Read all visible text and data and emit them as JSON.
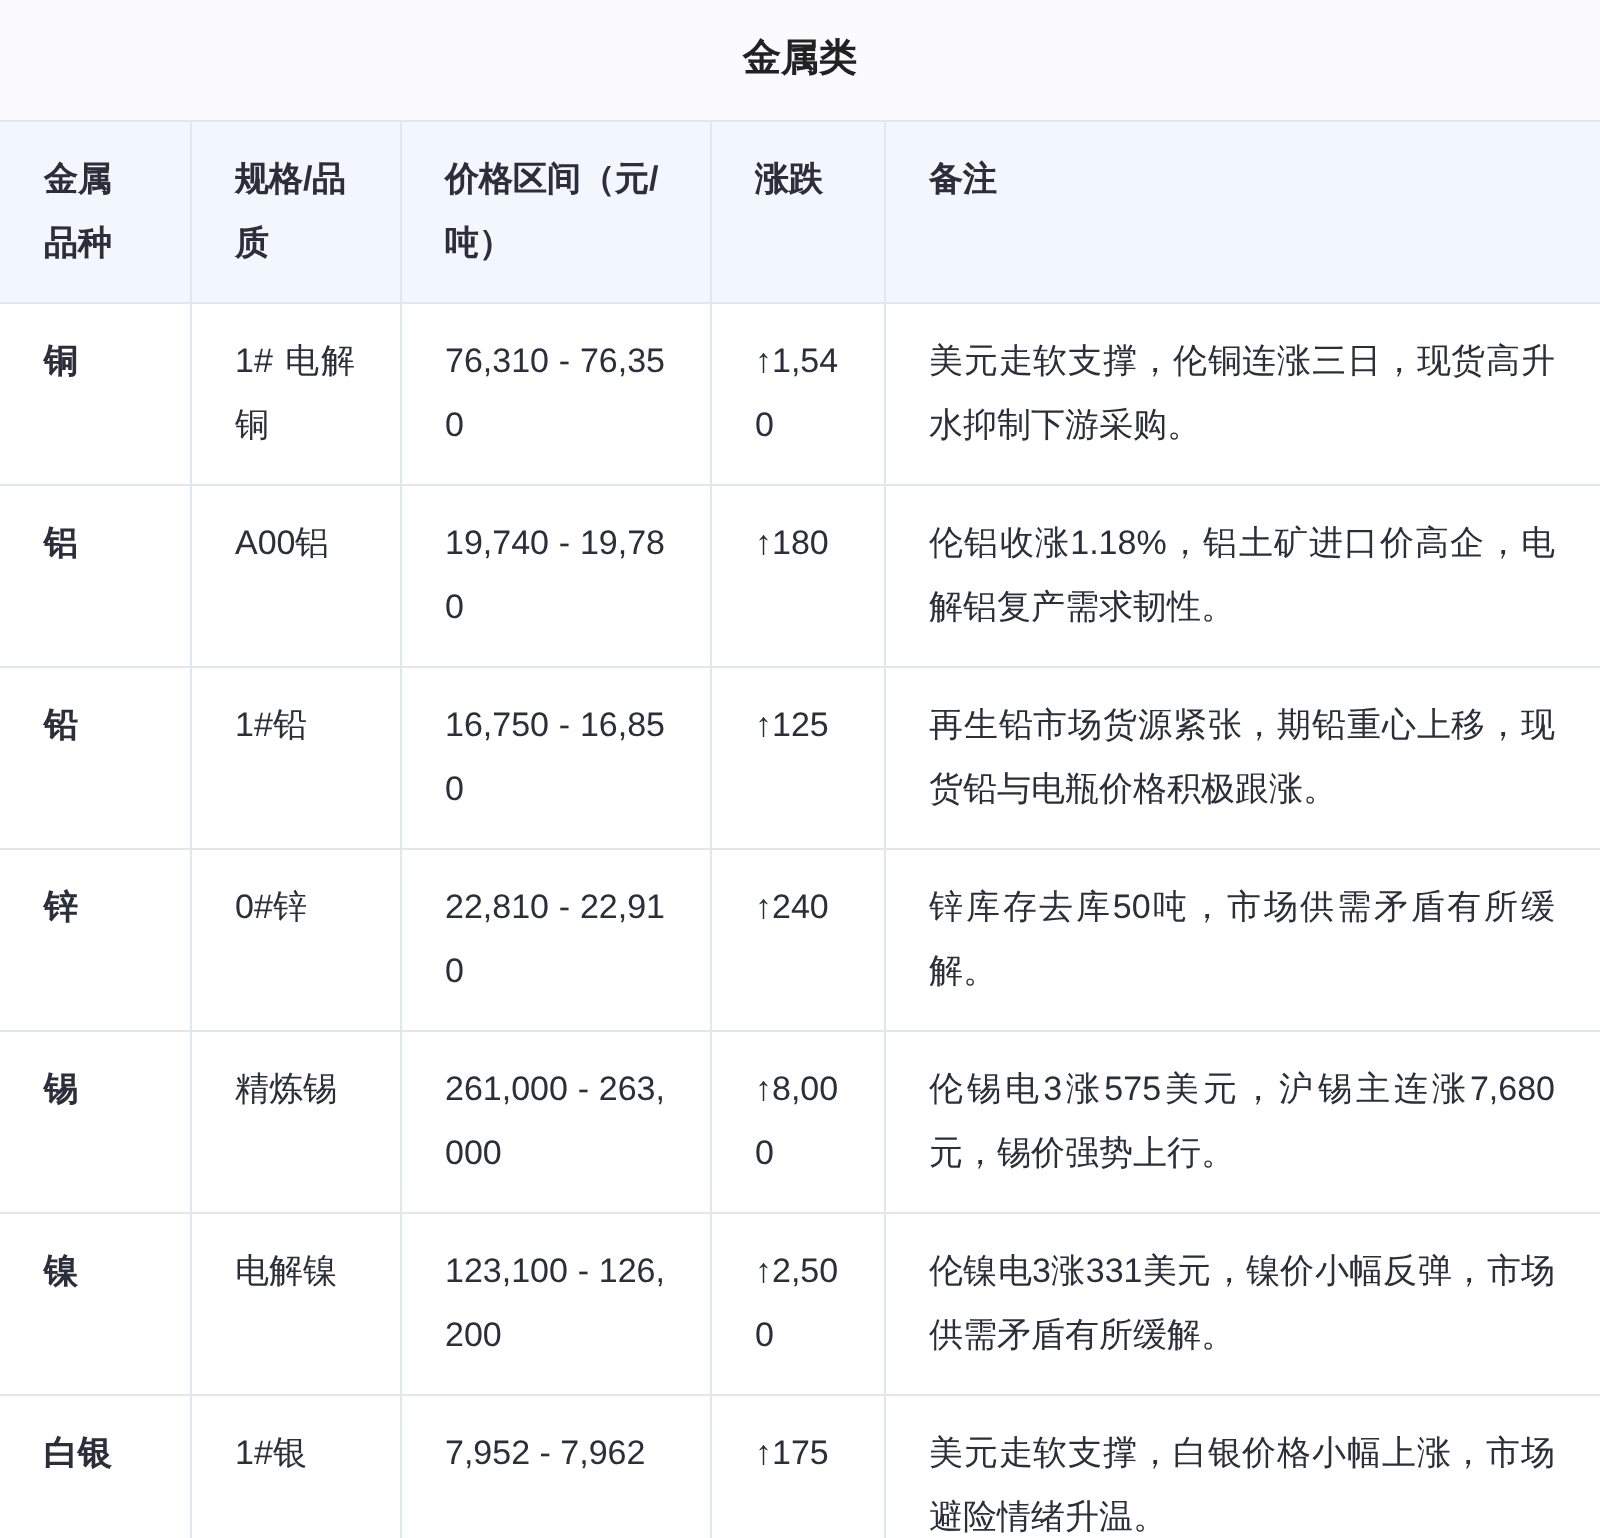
{
  "title": "金属类",
  "columns": [
    "金属品种",
    "规格/品质",
    "价格区间（元/吨）",
    "涨跌",
    "备注"
  ],
  "rows": [
    {
      "metal": "铜",
      "grade": "1# 电解铜",
      "price": "76,310 - 76,350",
      "change": "↑1,540",
      "note": "美元走软支撑，伦铜连涨三日，现货高升水抑制下游采购。"
    },
    {
      "metal": "铝",
      "grade": "A00铝",
      "price": "19,740 - 19,780",
      "change": "↑180",
      "note": "伦铝收涨1.18%，铝土矿进口价高企，电解铝复产需求韧性。"
    },
    {
      "metal": "铅",
      "grade": "1#铅",
      "price": "16,750 - 16,850",
      "change": "↑125",
      "note": "再生铅市场货源紧张，期铅重心上移，现货铅与电瓶价格积极跟涨。"
    },
    {
      "metal": "锌",
      "grade": "0#锌",
      "price": "22,810 - 22,910",
      "change": "↑240",
      "note": "锌库存去库50吨，市场供需矛盾有所缓解。"
    },
    {
      "metal": "锡",
      "grade": "精炼锡",
      "price": "261,000 - 263,000",
      "change": "↑8,000",
      "note": "伦锡电3涨575美元，沪锡主连涨7,680元，锡价强势上行。"
    },
    {
      "metal": "镍",
      "grade": "电解镍",
      "price": "123,100 - 126,200",
      "change": "↑2,500",
      "note": "伦镍电3涨331美元，镍价小幅反弹，市场供需矛盾有所缓解。"
    },
    {
      "metal": "白银",
      "grade": "1#银",
      "price": "7,952 - 7,962",
      "change": "↑175",
      "note": "美元走软支撑，白银价格小幅上涨，市场避险情绪升温。"
    }
  ]
}
